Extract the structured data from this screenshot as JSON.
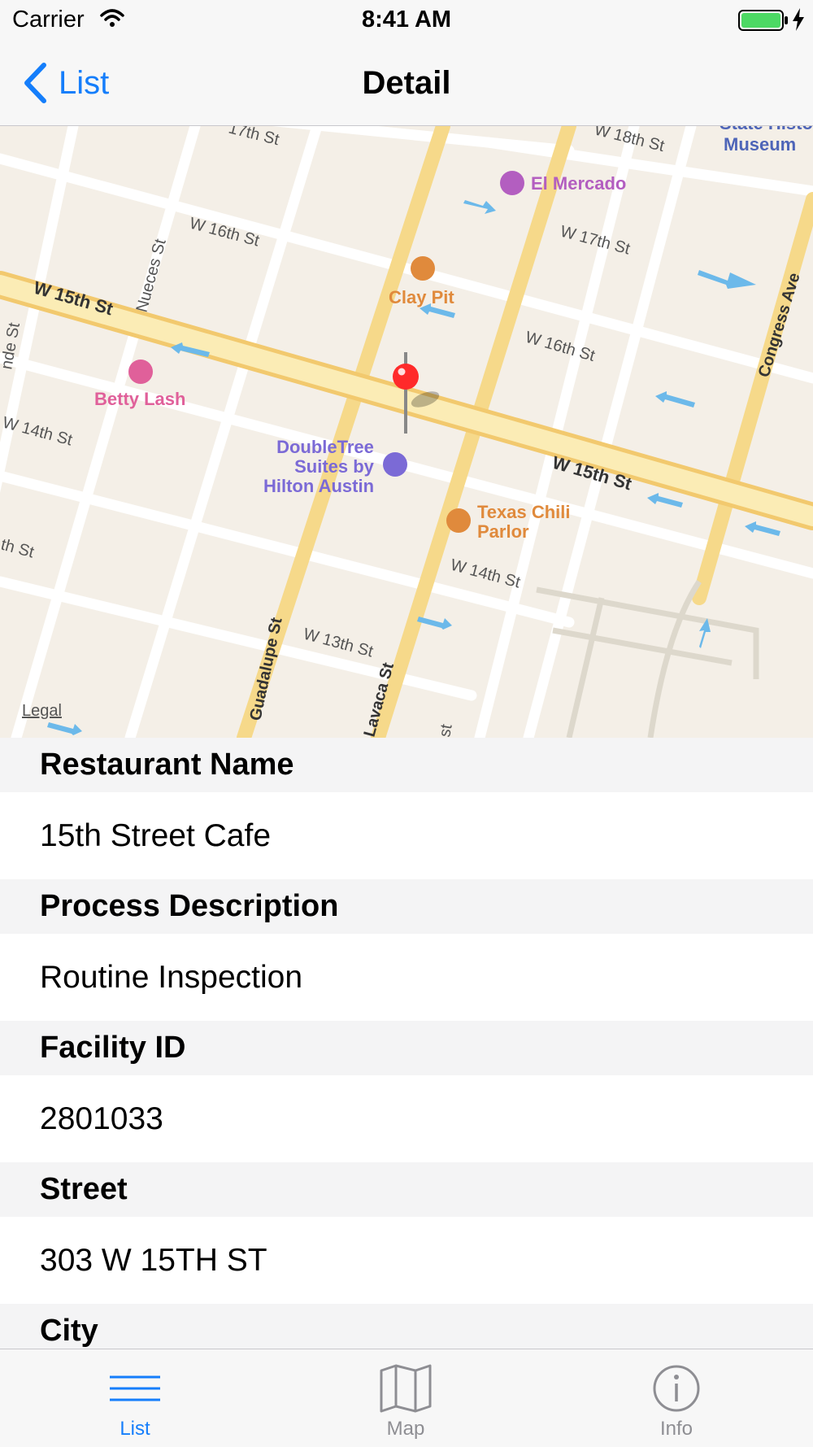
{
  "status_bar": {
    "carrier": "Carrier",
    "time": "8:41 AM"
  },
  "nav_bar": {
    "back_label": "List",
    "title": "Detail"
  },
  "map": {
    "pois": [
      {
        "label": "El Mercado",
        "color": "#b35ec0"
      },
      {
        "label": "Clay Pit",
        "color": "#e08a3c"
      },
      {
        "label": "Betty Lash",
        "color": "#e0609a"
      },
      {
        "label": "DoubleTree Suites by Hilton Austin",
        "lines": [
          "DoubleTree",
          "Suites by",
          "Hilton Austin"
        ],
        "color": "#7b6ad6"
      },
      {
        "label": "Texas Chili Parlor",
        "lines": [
          "Texas Chili",
          "Parlor"
        ],
        "color": "#e08a3c"
      },
      {
        "label": "State History Museum",
        "lines": [
          "State Histo",
          "Museum"
        ],
        "color": "#4e65b8"
      }
    ],
    "streets": [
      "17th St",
      "W 18th St",
      "W 16th St",
      "W 17th St",
      "Nueces St",
      "W 15th St",
      "W 16th St",
      "Congress Ave",
      "nde St",
      "W 14th St",
      "W 15th St",
      "W 14th St",
      "th St",
      "Guadalupe St",
      "W 13th St",
      "Lavaca St",
      "st"
    ],
    "legal_label": "Legal",
    "pin_color": "#ff2a2a"
  },
  "sections": [
    {
      "header": "Restaurant Name",
      "value": "15th Street Cafe"
    },
    {
      "header": "Process Description",
      "value": "Routine Inspection"
    },
    {
      "header": "Facility ID",
      "value": "2801033"
    },
    {
      "header": "Street",
      "value": "303 W 15TH ST"
    },
    {
      "header": "City",
      "value": ""
    }
  ],
  "tab_bar": {
    "tabs": [
      {
        "label": "List",
        "icon": "list-icon",
        "selected": true
      },
      {
        "label": "Map",
        "icon": "map-icon",
        "selected": false
      },
      {
        "label": "Info",
        "icon": "info-icon",
        "selected": false
      }
    ],
    "active_color": "#157efb",
    "inactive_color": "#8e8e93"
  }
}
